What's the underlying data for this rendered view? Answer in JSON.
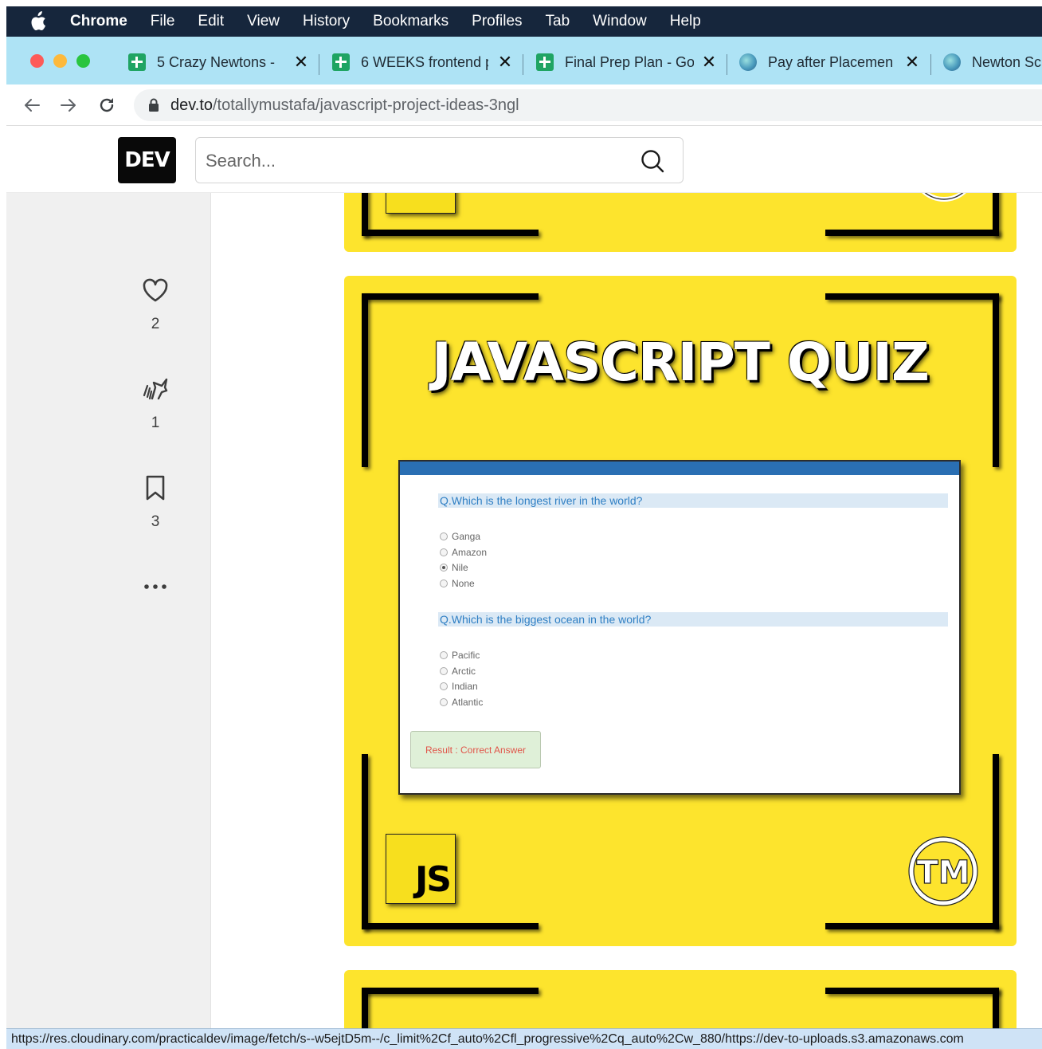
{
  "menubar": {
    "items": [
      "Chrome",
      "File",
      "Edit",
      "View",
      "History",
      "Bookmarks",
      "Profiles",
      "Tab",
      "Window",
      "Help"
    ]
  },
  "tabs": [
    {
      "title": "5 Crazy Newtons - ",
      "icon": "sheets-icon"
    },
    {
      "title": "6 WEEKS frontend p",
      "icon": "sheets-icon"
    },
    {
      "title": "Final Prep Plan - Go",
      "icon": "sheets-icon"
    },
    {
      "title": "Pay after Placemen",
      "icon": "globe-icon"
    },
    {
      "title": "Newton Sc",
      "icon": "globe-icon"
    }
  ],
  "address": {
    "host": "dev.to",
    "path": "/totallymustafa/javascript-project-ideas-3ngl"
  },
  "devto": {
    "logo": "DEV",
    "search_placeholder": "Search..."
  },
  "reactions": [
    {
      "icon": "heart-icon",
      "count": "2"
    },
    {
      "icon": "unicorn-icon",
      "count": "1"
    },
    {
      "icon": "bookmark-icon",
      "count": "3"
    }
  ],
  "article_image": {
    "title": "JAVASCRIPT QUIZ",
    "questions": [
      {
        "text": "Q.Which is the longest river in the world?",
        "options": [
          "Ganga",
          "Amazon",
          "Nile",
          "None"
        ],
        "selected": 2
      },
      {
        "text": "Q.Which is the biggest ocean in the world?",
        "options": [
          "Pacific",
          "Arctic",
          "Indian",
          "Atlantic"
        ],
        "selected": -1
      }
    ],
    "result": "Result : Correct Answer",
    "badge": "JS",
    "logo": "TM"
  },
  "statusbar": {
    "url": "https://res.cloudinary.com/practicaldev/image/fetch/s--w5ejtD5m--/c_limit%2Cf_auto%2Cfl_progressive%2Cq_auto%2Cw_880/https://dev-to-uploads.s3.amazonaws.com"
  },
  "colors": {
    "menubar": "#16263c",
    "tabstrip": "#aee3f5",
    "card_yellow": "#fde42d",
    "quiz_blue": "#2a6fb3"
  }
}
